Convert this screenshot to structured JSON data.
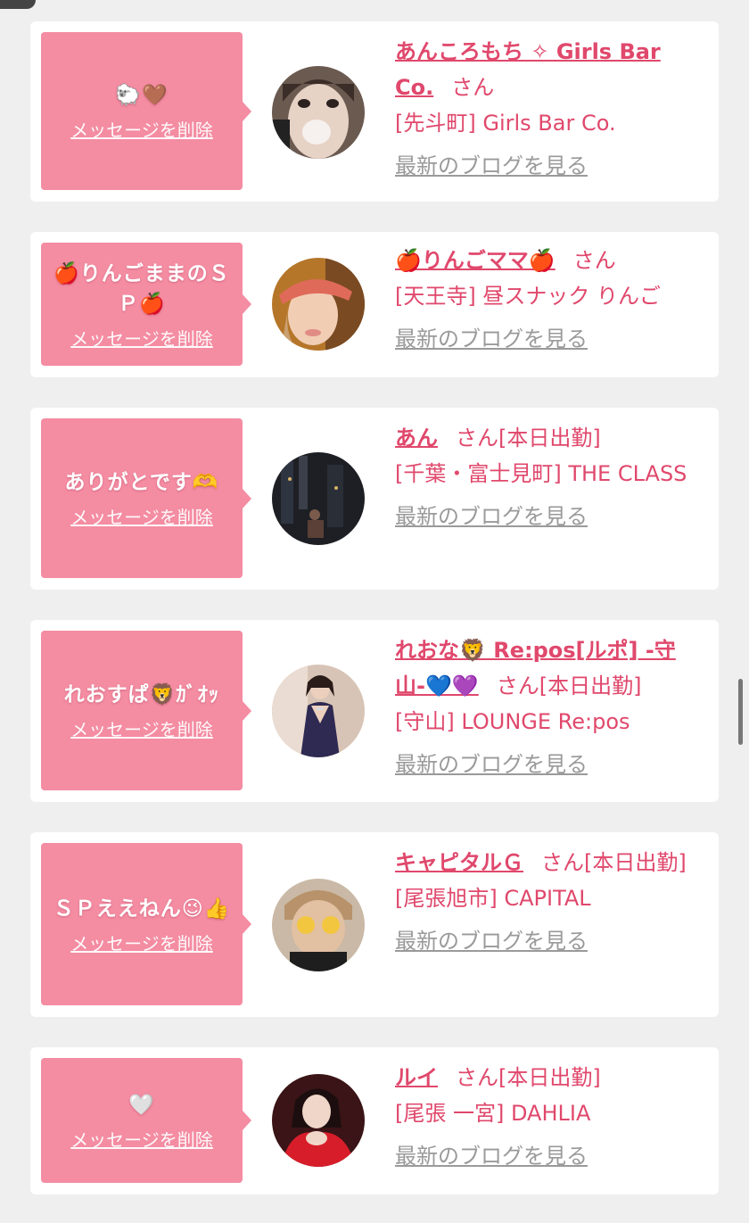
{
  "delete_label": "メッセージを削除",
  "blog_label": "最新のブログを見る",
  "san_label": "さん",
  "colors": {
    "accent": "#e0486c",
    "message_bg": "#f48ca2",
    "link_gray": "#9a9a9a",
    "page_bg": "#efefef"
  },
  "entries": [
    {
      "message": "🐑🤎",
      "name": "あんころもち ✧ Girls Bar Co.",
      "status": "",
      "shop": "[先斗町] Girls Bar Co."
    },
    {
      "message": "🍎りんごままのＳＰ🍎",
      "name": "🍎りんごママ🍎",
      "status": "",
      "shop": "[天王寺] 昼スナック りんご"
    },
    {
      "message": "ありがとです🫶",
      "name": "あん",
      "status": "[本日出勤]",
      "shop": "[千葉・富士見町] THE CLASS"
    },
    {
      "message": "れおすぱ🦁ｶﾞｵｯ",
      "name": "れおな🦁 Re:pos[ルポ] -守山-💙💜",
      "status": "[本日出勤]",
      "shop": "[守山] LOUNGE Re:pos"
    },
    {
      "message": "ＳＰええねん😉👍",
      "name": "キャピタルＧ",
      "status": "[本日出勤]",
      "shop": "[尾張旭市] CAPITAL"
    },
    {
      "message": "🤍",
      "name": "ルイ",
      "status": "[本日出勤]",
      "shop": "[尾張 一宮] DAHLIA"
    }
  ]
}
